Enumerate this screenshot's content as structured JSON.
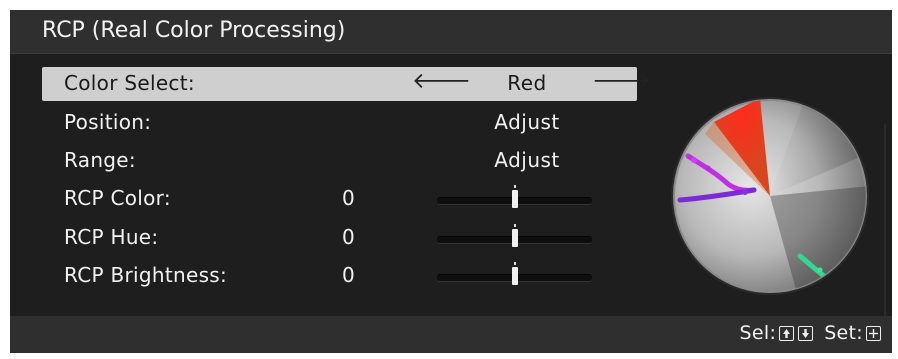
{
  "title": "RCP (Real Color Processing)",
  "menu": {
    "color_select": {
      "label": "Color Select:",
      "value": "Red"
    },
    "position": {
      "label": "Position:",
      "value": "Adjust"
    },
    "range": {
      "label": "Range:",
      "value": "Adjust"
    },
    "rcp_color": {
      "label": "RCP Color:",
      "value": "0"
    },
    "rcp_hue": {
      "label": "RCP Hue:",
      "value": "0"
    },
    "rcp_brightness": {
      "label": "RCP Brightness:",
      "value": "0"
    }
  },
  "sliders": {
    "rcp_color": 0.5,
    "rcp_hue": 0.5,
    "rcp_brightness": 0.5
  },
  "footer": {
    "sel_label": "Sel:",
    "set_label": "Set:"
  },
  "colors": {
    "selected_red": "#e8321e",
    "magenta_plot": "#c030e0",
    "green_plot": "#30d890",
    "panel": "#1b1b1b",
    "highlight": "#cfcfcf"
  },
  "icons": [
    "left-arrow-icon",
    "right-arrow-icon",
    "up-key-icon",
    "down-key-icon",
    "enter-key-icon"
  ]
}
